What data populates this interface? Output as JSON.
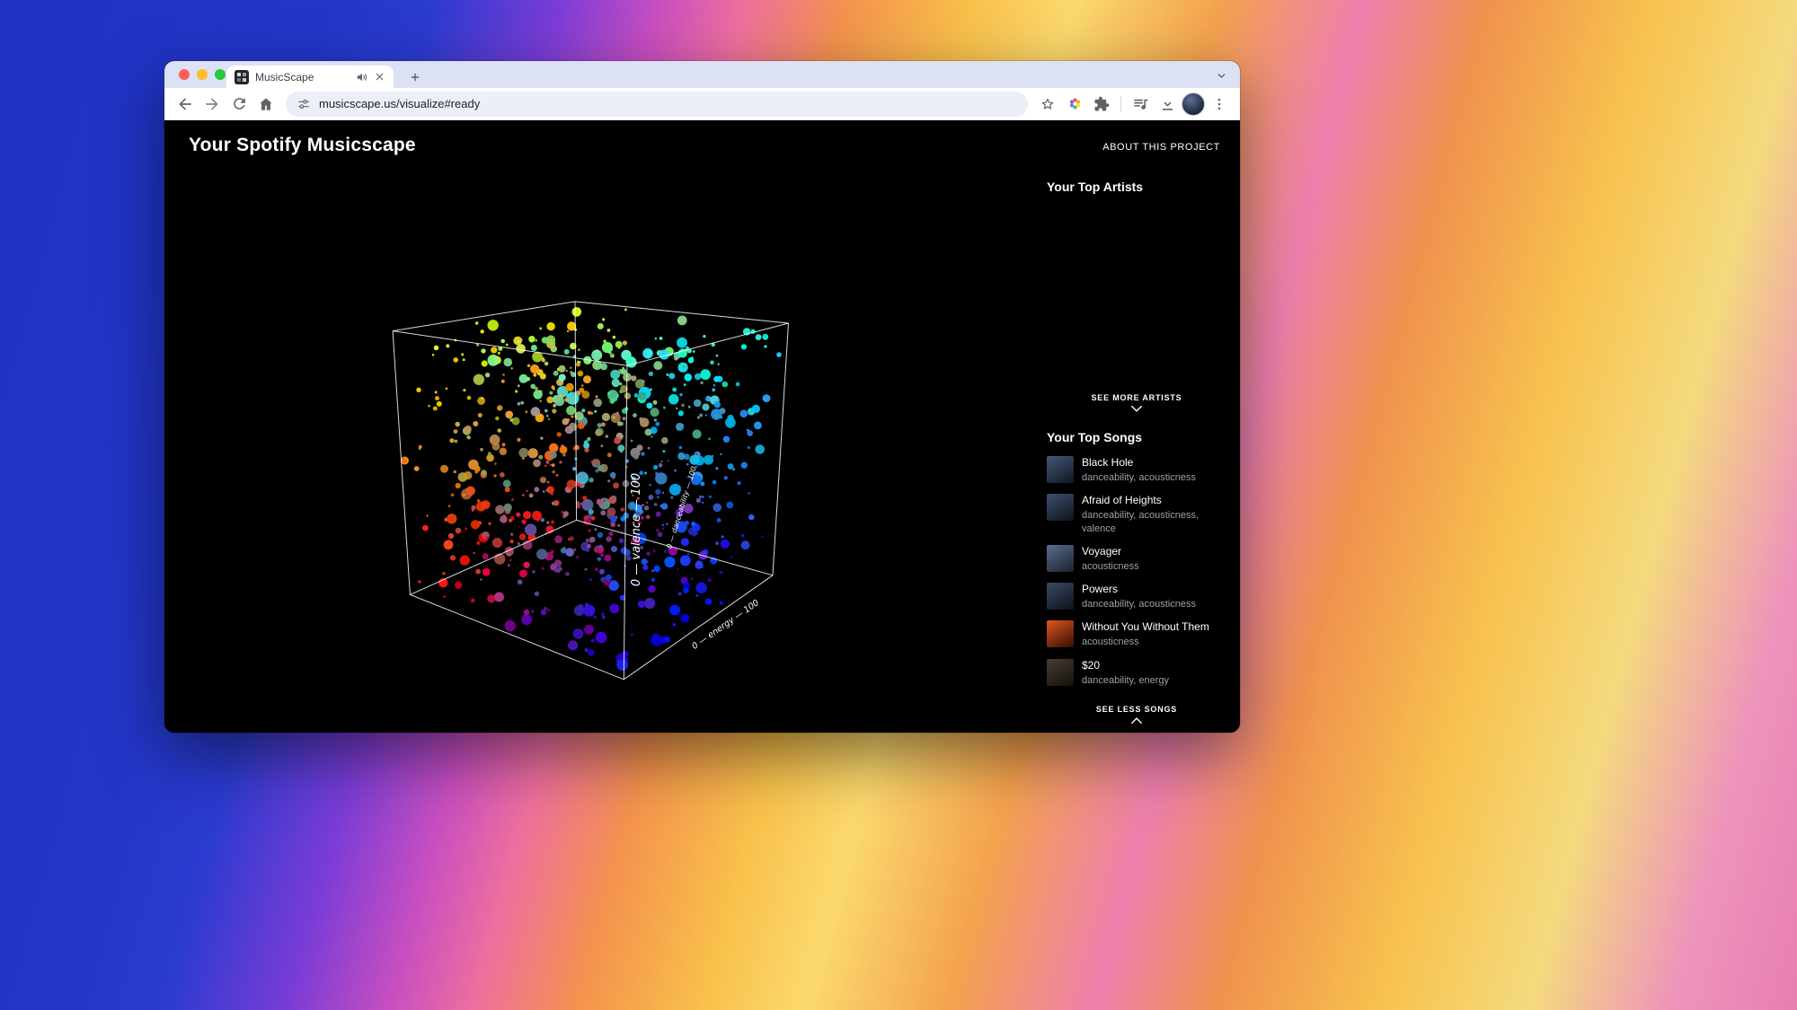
{
  "browser": {
    "tab_title": "MusicScape",
    "url": "musicscape.us/visualize#ready"
  },
  "page": {
    "title": "Your Spotify Musicscape",
    "about_link": "ABOUT THIS PROJECT"
  },
  "visualization": {
    "type": "3d-scatter",
    "seed": 1337,
    "point_count": 760,
    "axis_labels": [
      "0 — valence — 100",
      "0 — danceability — 100",
      "0 — energy — 100"
    ],
    "background": "#000000"
  },
  "sidebar": {
    "artists_heading": "Your Top Artists",
    "see_more_label": "SEE MORE ARTISTS",
    "songs_heading": "Your Top Songs",
    "see_less_label": "SEE LESS SONGS",
    "songs": [
      {
        "title": "Black Hole",
        "features": "danceability, acousticness",
        "art_top": "#44597a",
        "art_bottom": "#10151f"
      },
      {
        "title": "Afraid of Heights",
        "features": "danceability, acousticness, valence",
        "art_top": "#3d5170",
        "art_bottom": "#0e1219"
      },
      {
        "title": "Voyager",
        "features": "acousticness",
        "art_top": "#5b6e8c",
        "art_bottom": "#18202e"
      },
      {
        "title": "Powers",
        "features": "danceability, acousticness",
        "art_top": "#3a4a66",
        "art_bottom": "#0d1118"
      },
      {
        "title": "Without You Without Them",
        "features": "acousticness",
        "art_top": "#e0561c",
        "art_bottom": "#320d06"
      },
      {
        "title": "$20",
        "features": "danceability, energy",
        "art_top": "#4a3c31",
        "art_bottom": "#14100c"
      }
    ]
  }
}
